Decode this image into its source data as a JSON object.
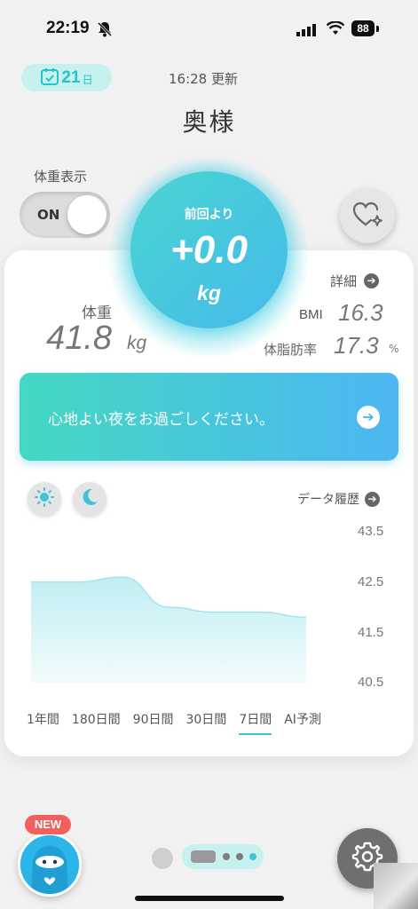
{
  "status_bar": {
    "time": "22:19",
    "battery": "88"
  },
  "header": {
    "day_count": "21",
    "day_unit": "日",
    "updated": "16:28 更新",
    "user_name": "奥様"
  },
  "weight_display": {
    "label": "体重表示",
    "toggle_text": "ON",
    "toggle_on": true
  },
  "bubble": {
    "label": "前回より",
    "value": "+0.0",
    "unit": "kg"
  },
  "stats": {
    "detail_label": "詳細",
    "weight_label": "体重",
    "weight_value": "41.8",
    "weight_unit": "kg",
    "bmi_label": "BMI",
    "bmi_value": "16.3",
    "fat_label": "体脂肪率",
    "fat_value": "17.3",
    "fat_unit": "%"
  },
  "message": {
    "text": "心地よい夜をお過ごしください。"
  },
  "history": {
    "label": "データ履歴"
  },
  "chart_data": {
    "type": "area",
    "y_ticks": [
      "43.5",
      "42.5",
      "41.5",
      "40.5"
    ],
    "ylim": [
      40.5,
      43.5
    ],
    "x": [
      0,
      1,
      2,
      3,
      4,
      5,
      6
    ],
    "values": [
      42.5,
      42.5,
      42.6,
      42.0,
      41.9,
      41.9,
      41.8
    ]
  },
  "ranges": {
    "items": [
      "1年間",
      "180日間",
      "90日間",
      "30日間",
      "7日間",
      "AI予測"
    ],
    "active": "7日間"
  },
  "bottom": {
    "new_badge": "NEW"
  },
  "colors": {
    "accent": "#45c4da",
    "gradient_start": "#44d8c2",
    "gradient_end": "#4cb6f2"
  }
}
